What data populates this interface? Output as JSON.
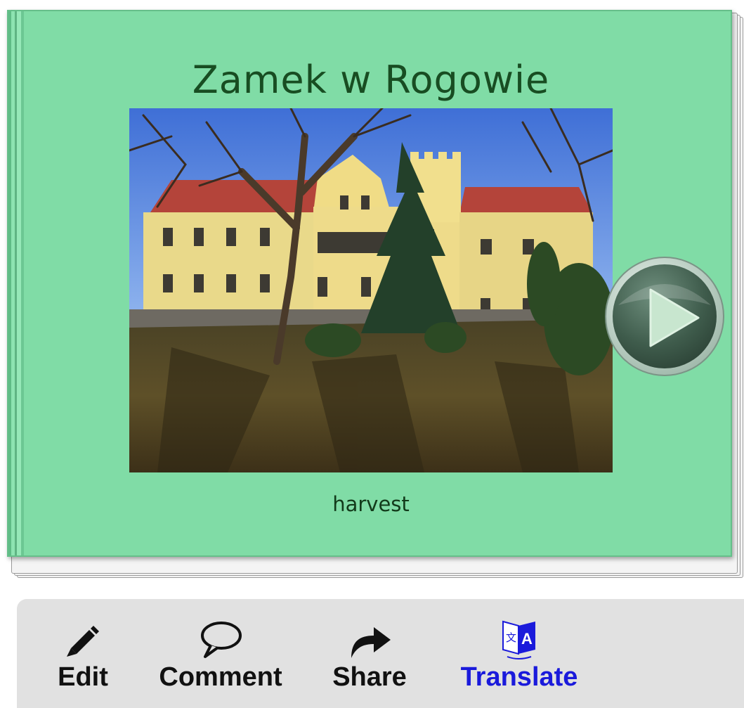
{
  "book": {
    "title": "Zamek w Rogowie",
    "caption": "harvest",
    "cover_color": "#80dca6",
    "photo_icon": "castle-photo",
    "play_icon": "play-icon"
  },
  "toolbar": {
    "edit_label": "Edit",
    "edit_icon": "pencil-icon",
    "comment_label": "Comment",
    "comment_icon": "speech-bubble-icon",
    "share_label": "Share",
    "share_icon": "share-arrow-icon",
    "translate_label": "Translate",
    "translate_icon": "translate-icon",
    "translate_color": "#1a1adb"
  }
}
